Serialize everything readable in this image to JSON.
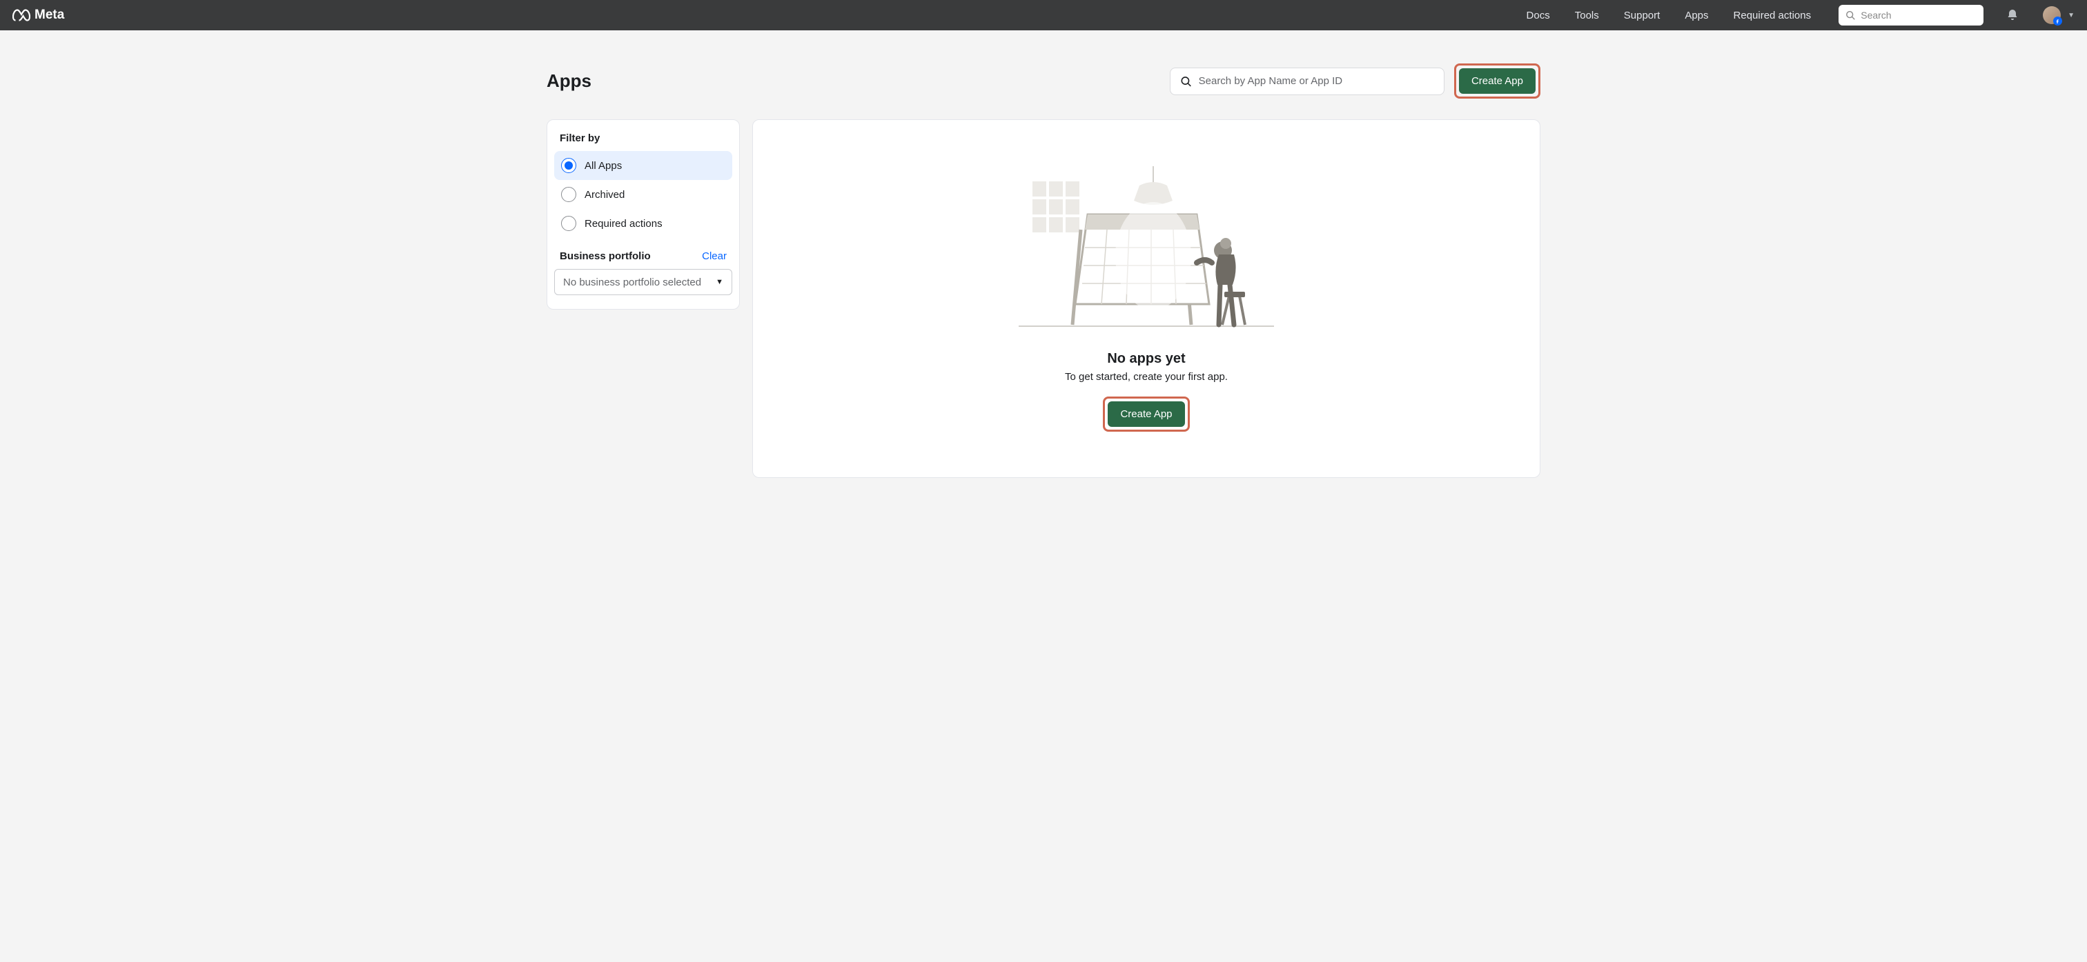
{
  "brand": "Meta",
  "nav": {
    "links": [
      "Docs",
      "Tools",
      "Support",
      "Apps",
      "Required actions"
    ],
    "search_placeholder": "Search"
  },
  "page": {
    "title": "Apps",
    "app_search_placeholder": "Search by App Name or App ID",
    "create_app_label": "Create App"
  },
  "sidebar": {
    "filter_title": "Filter by",
    "filter_options": [
      "All Apps",
      "Archived",
      "Required actions"
    ],
    "selected_filter_index": 0,
    "bp_title": "Business portfolio",
    "clear_label": "Clear",
    "bp_select_text": "No business portfolio selected"
  },
  "empty_state": {
    "title": "No apps yet",
    "text": "To get started, create your first app.",
    "create_app_label": "Create App"
  },
  "colors": {
    "accent": "#2b6a47",
    "highlight": "#d0674f",
    "link": "#0866ff"
  }
}
